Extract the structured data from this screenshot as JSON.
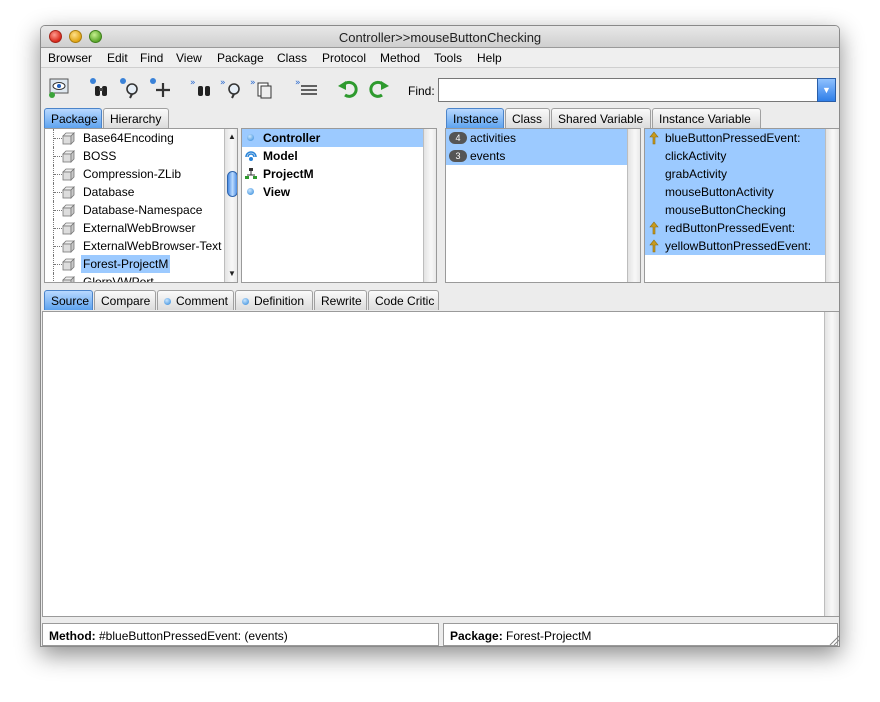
{
  "window": {
    "title": "Controller>>mouseButtonChecking"
  },
  "menu": [
    "Browser",
    "Edit",
    "Find",
    "View",
    "Package",
    "Class",
    "Protocol",
    "Method",
    "Tools",
    "Help"
  ],
  "toolbar": {
    "icons": [
      "browse-eye-icon",
      "find-binoculars-icon",
      "find-magnifier-icon",
      "add-icon",
      "binoculars-forward-icon",
      "magnifier-forward-icon",
      "copy-forward-icon",
      "list-forward-icon",
      "undo-icon",
      "redo-icon"
    ],
    "find_label": "Find:",
    "find_value": "",
    "accent": "#5ea3ef"
  },
  "package_tabs": [
    "Package",
    "Hierarchy"
  ],
  "packages": [
    "Base64Encoding",
    "BOSS",
    "Compression-ZLib",
    "Database",
    "Database-Namespace",
    "ExternalWebBrowser",
    "ExternalWebBrowser-Text",
    "Forest-ProjectM",
    "GlorpVWPort"
  ],
  "selected_package": "Forest-ProjectM",
  "classes": [
    "Controller",
    "Model",
    "ProjectM",
    "View"
  ],
  "class_tabs": [
    "Instance",
    "Class",
    "Shared Variable",
    "Instance Variable"
  ],
  "protocols": [
    {
      "count": "4",
      "name": "activities"
    },
    {
      "count": "3",
      "name": "events"
    }
  ],
  "methods": [
    "blueButtonPressedEvent:",
    "clickActivity",
    "grabActivity",
    "mouseButtonActivity",
    "mouseButtonChecking",
    "redButtonPressedEvent:",
    "yellowButtonPressedEvent:"
  ],
  "code_tabs": [
    "Source",
    "Compare",
    "Comment",
    "Definition",
    "Rewrite",
    "Code Critic"
  ],
  "source_code": "",
  "status": {
    "method_label": "Method:",
    "method_value": "#blueButtonPressedEvent: (events)",
    "package_label": "Package:",
    "package_value": "Forest-ProjectM"
  }
}
